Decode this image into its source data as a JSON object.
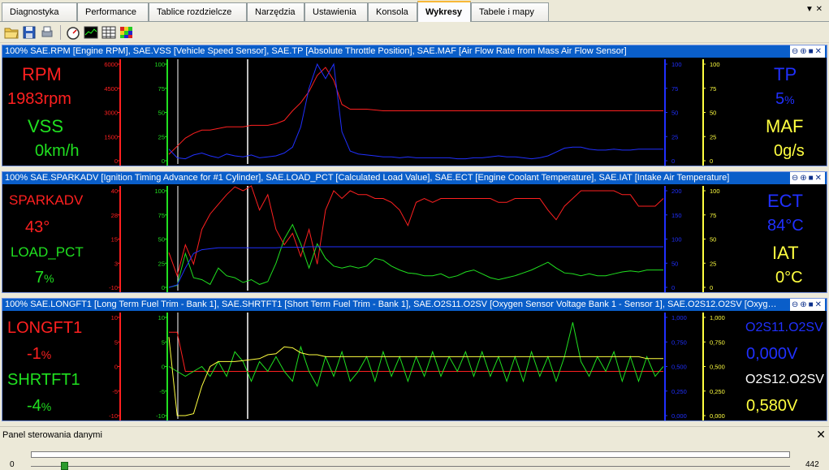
{
  "tabs": [
    {
      "label": "Diagnostyka",
      "active": false
    },
    {
      "label": "Performance",
      "active": false
    },
    {
      "label": "Tablice rozdzielcze",
      "active": false
    },
    {
      "label": "Narzędzia",
      "active": false
    },
    {
      "label": "Ustawienia",
      "active": false
    },
    {
      "label": "Konsola",
      "active": false
    },
    {
      "label": "Wykresy",
      "active": true
    },
    {
      "label": "Tabele i mapy",
      "active": false
    }
  ],
  "toolbar": {
    "icons": [
      "open-folder-icon",
      "save-icon",
      "print-icon",
      "gauge-icon",
      "chart-icon",
      "table-icon",
      "heatmap-icon"
    ]
  },
  "panels": [
    {
      "title": "100% SAE.RPM [Engine RPM], SAE.VSS [Vehicle Speed Sensor], SAE.TP [Absolute Throttle Position], SAE.MAF [Air Flow Rate from Mass Air Flow Sensor]",
      "left": [
        {
          "name": "RPM",
          "value": "1983rpm",
          "unit": "",
          "color": "#ff2020"
        },
        {
          "name": "VSS",
          "value": "0km/h",
          "unit": "",
          "color": "#20e020"
        }
      ],
      "right": [
        {
          "name": "TP",
          "value": "5",
          "unit": "%",
          "color": "#2030ff"
        },
        {
          "name": "MAF",
          "value": "0g/s",
          "unit": "",
          "color": "#ffff40"
        }
      ],
      "axes": [
        {
          "color": "#ff2020",
          "ticks": [
            "6000",
            "4500",
            "3000",
            "1500",
            "0"
          ]
        },
        {
          "color": "#20e020",
          "ticks": [
            "100",
            "75",
            "50",
            "25",
            "0"
          ]
        },
        {
          "color": "#2030ff",
          "ticks": [
            "100",
            "75",
            "50",
            "25",
            "0"
          ]
        },
        {
          "color": "#ffff40",
          "ticks": [
            "100",
            "75",
            "50",
            "25",
            "0"
          ]
        }
      ],
      "series": [
        {
          "color": "#ff2020",
          "axis": 0,
          "values": [
            400,
            900,
            1400,
            1700,
            1900,
            1900,
            2000,
            2100,
            2100,
            2100,
            2200,
            2200,
            2200,
            2300,
            2500,
            3100,
            3600,
            4300,
            5300,
            5800,
            5000,
            3500,
            3200,
            3200,
            3200,
            3150,
            3100,
            3100,
            3100,
            3100,
            3100,
            3100,
            3100,
            3100,
            3100,
            3100,
            3100,
            3100,
            3100,
            3100,
            3100,
            3100,
            3100,
            3100,
            3100,
            3100,
            3100,
            3100,
            3100,
            3100,
            3100,
            3100,
            3100,
            3100,
            3100,
            3100,
            3100,
            3100,
            3100,
            3100,
            3100
          ]
        },
        {
          "color": "#2030ff",
          "axis": 2,
          "values": [
            12,
            3,
            2,
            6,
            8,
            5,
            3,
            7,
            5,
            4,
            6,
            3,
            4,
            5,
            8,
            14,
            35,
            75,
            100,
            85,
            100,
            30,
            10,
            7,
            6,
            5,
            4,
            4,
            3,
            4,
            3,
            3,
            3,
            3,
            3,
            2,
            2,
            3,
            3,
            4,
            5,
            4,
            4,
            3,
            2,
            3,
            5,
            9,
            13,
            14,
            14,
            12,
            11,
            11,
            12,
            11,
            11,
            12,
            12,
            12,
            12
          ]
        }
      ]
    },
    {
      "title": "100% SAE.SPARKADV [Ignition Timing Advance for #1 Cylinder], SAE.LOAD_PCT [Calculated Load Value], SAE.ECT [Engine Coolant Temperature], SAE.IAT [Intake Air Temperature]",
      "left": [
        {
          "name": "SPARKADV",
          "value": "43",
          "unit": "°",
          "color": "#ff2020"
        },
        {
          "name": "LOAD_PCT",
          "value": "7",
          "unit": "%",
          "color": "#20e020"
        }
      ],
      "right": [
        {
          "name": "ECT",
          "value": "84",
          "unit": "°C",
          "color": "#2030ff"
        },
        {
          "name": "IAT",
          "value": "0",
          "unit": "°C",
          "color": "#ffff40"
        }
      ],
      "axes": [
        {
          "color": "#ff2020",
          "ticks": [
            "40",
            "28",
            "15",
            "3",
            "-10"
          ]
        },
        {
          "color": "#20e020",
          "ticks": [
            "100",
            "75",
            "50",
            "25",
            "0"
          ]
        },
        {
          "color": "#2030ff",
          "ticks": [
            "200",
            "150",
            "100",
            "50",
            "0"
          ]
        },
        {
          "color": "#ffff40",
          "ticks": [
            "100",
            "75",
            "50",
            "25",
            "0"
          ]
        }
      ],
      "series": [
        {
          "color": "#ff2020",
          "axis": 0,
          "values": [
            8,
            -4,
            12,
            2,
            20,
            28,
            33,
            38,
            42,
            40,
            44,
            30,
            38,
            20,
            12,
            18,
            6,
            20,
            2,
            30,
            40,
            36,
            40,
            38,
            38,
            36,
            36,
            34,
            30,
            22,
            34,
            36,
            34,
            36,
            36,
            36,
            36,
            36,
            36,
            36,
            34,
            34,
            36,
            36,
            36,
            36,
            30,
            25,
            32,
            36,
            40,
            40,
            40,
            40,
            40,
            38,
            38,
            32,
            32,
            32,
            36
          ]
        },
        {
          "color": "#20e020",
          "axis": 1,
          "values": [
            0,
            2,
            35,
            10,
            8,
            3,
            20,
            12,
            10,
            5,
            8,
            3,
            6,
            25,
            50,
            65,
            45,
            20,
            45,
            30,
            22,
            20,
            22,
            20,
            22,
            30,
            28,
            22,
            18,
            15,
            14,
            12,
            12,
            14,
            10,
            12,
            16,
            18,
            14,
            10,
            8,
            10,
            12,
            15,
            18,
            22,
            26,
            20,
            15,
            14,
            12,
            14,
            12,
            12,
            14,
            16,
            17,
            16,
            18,
            18,
            18
          ]
        },
        {
          "color": "#2030ff",
          "axis": 2,
          "values": [
            0,
            5,
            40,
            70,
            78,
            80,
            82,
            82,
            82,
            82,
            82,
            82,
            82,
            82,
            83,
            83,
            83,
            84,
            84,
            84,
            84,
            84,
            84,
            84,
            84,
            84,
            84,
            84,
            84,
            84,
            84,
            84,
            84,
            84,
            84,
            84,
            84,
            84,
            84,
            84,
            84,
            84,
            84,
            84,
            84,
            84,
            84,
            84,
            84,
            84,
            84,
            84,
            84,
            84,
            84,
            84,
            84,
            84,
            84,
            84,
            84
          ]
        }
      ]
    },
    {
      "title": "100% SAE.LONGFT1 [Long Term Fuel Trim - Bank 1], SAE.SHRTFT1 [Short Term Fuel Trim - Bank 1], SAE.O2S11.O2SV [Oxygen Sensor Voltage Bank 1 - Sensor 1], SAE.O2S12.O2SV [Oxygen Senso...",
      "left": [
        {
          "name": "LONGFT1",
          "value": "-1",
          "unit": "%",
          "color": "#ff2020"
        },
        {
          "name": "SHRTFT1",
          "value": "-4",
          "unit": "%",
          "color": "#20e020"
        }
      ],
      "right": [
        {
          "name": "O2S11.O2SV",
          "value": "0,000V",
          "unit": "",
          "color": "#2030ff"
        },
        {
          "name": "O2S12.O2SV",
          "value": "0,580V",
          "unit": "",
          "color": "#ffff40"
        }
      ],
      "axes": [
        {
          "color": "#ff2020",
          "ticks": [
            "10",
            "5",
            "0",
            "-5",
            "-10"
          ]
        },
        {
          "color": "#20e020",
          "ticks": [
            "10",
            "5",
            "0",
            "-5",
            "-10"
          ]
        },
        {
          "color": "#2030ff",
          "ticks": [
            "1,000",
            "0,750",
            "0,500",
            "0,250",
            "0,000"
          ]
        },
        {
          "color": "#ffff40",
          "ticks": [
            "1,000",
            "0,750",
            "0,500",
            "0,250",
            "0,000"
          ]
        }
      ],
      "series": [
        {
          "color": "#ff2020",
          "axis": 0,
          "values": [
            7,
            7,
            -1,
            -1,
            -1,
            -1,
            -1,
            -1,
            -1,
            -1,
            -1,
            -1,
            -1,
            -1,
            -1,
            -1,
            -1,
            -1,
            -1,
            -1,
            -1,
            -1,
            -1,
            -1,
            -1,
            -1,
            -1,
            -1,
            -1,
            -1,
            -1,
            -1,
            -1,
            -1,
            -1,
            -1,
            -1,
            -1,
            -1,
            -1,
            -1,
            -1,
            -1,
            -1,
            -1,
            -1,
            -1,
            -1,
            -1,
            -1,
            -1,
            -1,
            -1,
            -1,
            -1,
            -1,
            -1,
            -1,
            -1,
            -1,
            -1
          ]
        },
        {
          "color": "#20e020",
          "axis": 1,
          "values": [
            0,
            -1,
            -2,
            -1,
            0,
            -2,
            1,
            -2,
            3,
            1,
            -3,
            1,
            -1,
            2,
            -1,
            -3,
            4,
            -1,
            -4,
            2,
            -2,
            3,
            -3,
            -1,
            2,
            -3,
            3,
            -2,
            2,
            -3,
            2,
            -2,
            3,
            -2,
            2,
            -1,
            3,
            -2,
            3,
            -2,
            2,
            -3,
            2,
            -3,
            3,
            -2,
            2,
            -3,
            2,
            9,
            1,
            -2,
            2,
            -1,
            3,
            -3,
            2,
            -3,
            2,
            -2,
            0
          ]
        },
        {
          "color": "#ffff40",
          "axis": 3,
          "values": [
            0.8,
            0.0,
            0.0,
            0.02,
            0.3,
            0.5,
            0.55,
            0.55,
            0.55,
            0.56,
            0.57,
            0.58,
            0.62,
            0.63,
            0.7,
            0.69,
            0.64,
            0.62,
            0.62,
            0.6,
            0.6,
            0.6,
            0.6,
            0.6,
            0.6,
            0.6,
            0.6,
            0.6,
            0.6,
            0.6,
            0.6,
            0.6,
            0.6,
            0.6,
            0.6,
            0.6,
            0.6,
            0.6,
            0.6,
            0.6,
            0.6,
            0.6,
            0.6,
            0.6,
            0.6,
            0.6,
            0.6,
            0.6,
            0.6,
            0.6,
            0.6,
            0.6,
            0.6,
            0.6,
            0.6,
            0.6,
            0.6,
            0.6,
            0.58,
            0.58,
            0.58
          ]
        }
      ]
    }
  ],
  "data_panel": {
    "title": "Panel sterowania danymi",
    "min": "0",
    "max": "442",
    "position_fraction": 0.04
  }
}
